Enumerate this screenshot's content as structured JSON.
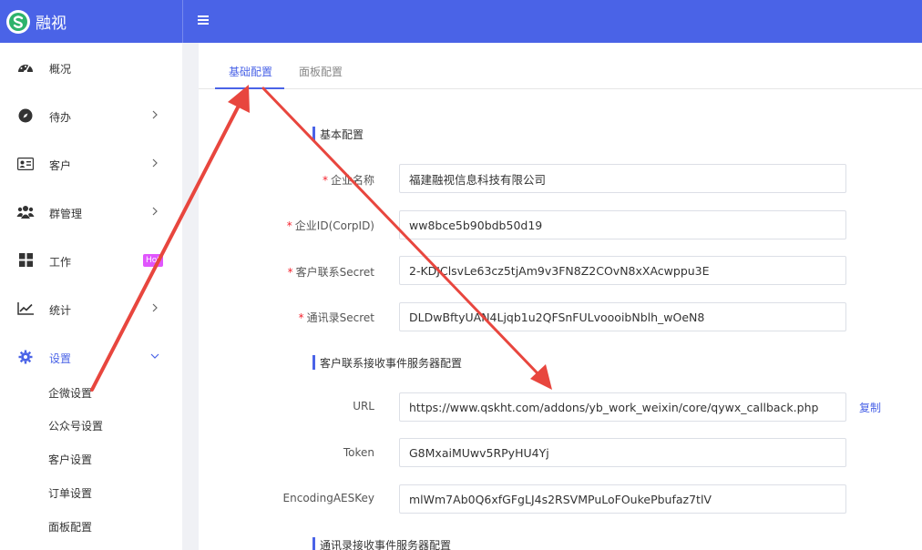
{
  "app": {
    "name": "融视"
  },
  "colors": {
    "brand": "#4a63e7",
    "arrow": "#e8463e",
    "required": "#f5222d",
    "badge": "#e056fd"
  },
  "sidebar": {
    "items": [
      {
        "label": "概况",
        "icon": "dashboard-icon"
      },
      {
        "label": "待办",
        "icon": "compass-icon"
      },
      {
        "label": "客户",
        "icon": "id-card-icon"
      },
      {
        "label": "群管理",
        "icon": "users-icon"
      },
      {
        "label": "工作",
        "icon": "grid-icon",
        "badge": "Hot"
      },
      {
        "label": "统计",
        "icon": "chart-line-icon"
      },
      {
        "label": "设置",
        "icon": "gear-icon"
      }
    ],
    "subitems": [
      "企微设置",
      "公众号设置",
      "客户设置",
      "订单设置",
      "面板配置"
    ]
  },
  "tabs": [
    "基础配置",
    "面板配置"
  ],
  "sections": {
    "basic": "基本配置",
    "customer_event": "客户联系接收事件服务器配置",
    "contacts_event": "通讯录接收事件服务器配置"
  },
  "form": {
    "company_name": {
      "label": "企业名称",
      "value": "福建融视信息科技有限公司"
    },
    "corp_id": {
      "label": "企业ID(CorpID)",
      "value": "ww8bce5b90bdb50d19"
    },
    "customer_secret": {
      "label": "客户联系Secret",
      "value": "2-KDJClsvLe63cz5tjAm9v3FN8Z2COvN8xXAcwppu3E"
    },
    "contacts_secret": {
      "label": "通讯录Secret",
      "value": "DLDwBftyUAN4Ljqb1u2QFSnFULvoooibNblh_wOeN8"
    },
    "url": {
      "label": "URL",
      "value": "https://www.qskht.com/addons/yb_work_weixin/core/qywx_callback.php"
    },
    "token": {
      "label": "Token",
      "value": "G8MxaiMUwv5RPyHU4Yj"
    },
    "aes_key": {
      "label": "EncodingAESKey",
      "value": "mlWm7Ab0Q6xfGFgLJ4s2RSVMPuLoFOukePbufaz7tlV"
    }
  },
  "copy_label": "复制"
}
